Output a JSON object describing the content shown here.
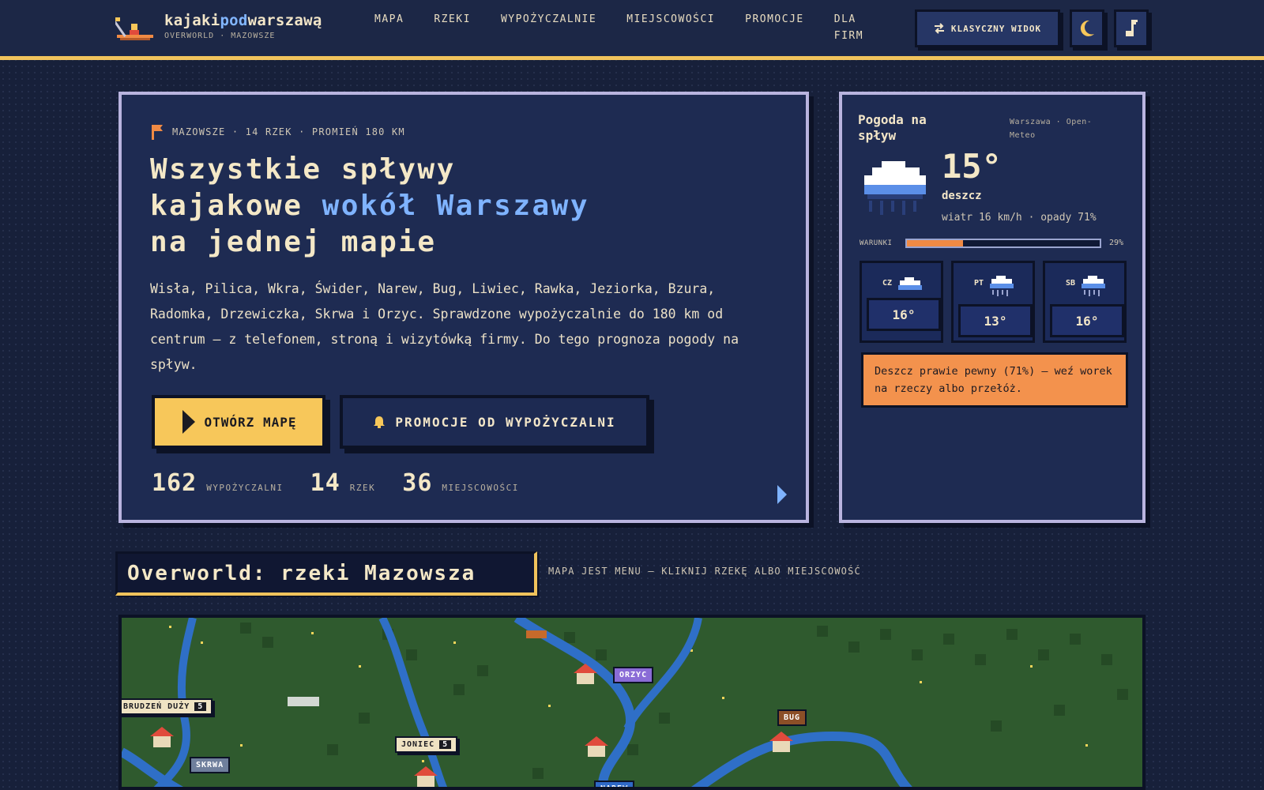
{
  "header": {
    "logo": {
      "prefix": "kajaki",
      "accent": "pod",
      "suffix": "warszawą",
      "tagline": "OVERWORLD · MAZOWSZE"
    },
    "nav": [
      "MAPA",
      "RZEKI",
      "WYPOŻYCZALNIE",
      "MIEJSCOWOŚCI",
      "PROMOCJE",
      "DLA FIRM"
    ],
    "classic_view_label": "KLASYCZNY WIDOK",
    "icons": {
      "classic": "swap-arrows-icon",
      "theme": "moon-icon",
      "music": "music-note-icon"
    }
  },
  "hero": {
    "kicker": "MAZOWSZE · 14 RZEK · PROMIEŃ 180 KM",
    "title_line1": "Wszystkie spływy",
    "title_line2_start": "kajakowe ",
    "title_line2_accent": "wokół Warszawy",
    "title_line3": "na jednej mapie",
    "description": "Wisła, Pilica, Wkra, Świder, Narew, Bug, Liwiec, Rawka, Jeziorka, Bzura, Radomka, Drzewiczka, Skrwa i Orzyc. Sprawdzone wypożyczalnie do 180 km od centrum – z telefonem, stroną i wizytówką firmy. Do tego prognoza pogody na spływ.",
    "primary_button": "OTWÓRZ MAPĘ",
    "secondary_button": "PROMOCJE OD WYPOŻYCZALNI",
    "stats": [
      {
        "value": "162",
        "label": "WYPOŻYCZALNI"
      },
      {
        "value": "14",
        "label": "RZEK"
      },
      {
        "value": "36",
        "label": "MIEJSCOWOŚCI"
      }
    ]
  },
  "weather": {
    "title": "Pogoda na spływ",
    "source": "Warszawa · Open-Meteo",
    "temperature": "15°",
    "condition": "deszcz",
    "details": "wiatr 16 km/h · opady 71%",
    "conditions_label": "WARUNKI",
    "conditions_value": 0.29,
    "conditions_percent": "29%",
    "forecast": [
      {
        "day": "CZ",
        "temp": "16°",
        "icon": "cloud-icon"
      },
      {
        "day": "PT",
        "temp": "13°",
        "icon": "rain-cloud-icon"
      },
      {
        "day": "SB",
        "temp": "16°",
        "icon": "rain-cloud-icon"
      }
    ],
    "alert": "Deszcz prawie pewny (71%) – weź worek na rzeczy albo przełóż."
  },
  "overworld": {
    "heading": "Overworld: rzeki Mazowsza",
    "hint": "MAPA JEST MENU – KLIKNIJ RZEKĘ ALBO MIEJSCOWOŚĆ",
    "markers": [
      {
        "name": "BRUDZEŃ DUŻY",
        "count": "5"
      },
      {
        "name": "JONIEC",
        "count": "5"
      }
    ],
    "rivers": [
      "ORZYC",
      "BUG",
      "SKRWA",
      "NAREW"
    ]
  },
  "colors": {
    "background": "#17203a",
    "accent_yellow": "#f7c75a",
    "accent_blue": "#7fb3ff",
    "accent_orange": "#f3924d",
    "panel_border": "#b9b4df"
  }
}
